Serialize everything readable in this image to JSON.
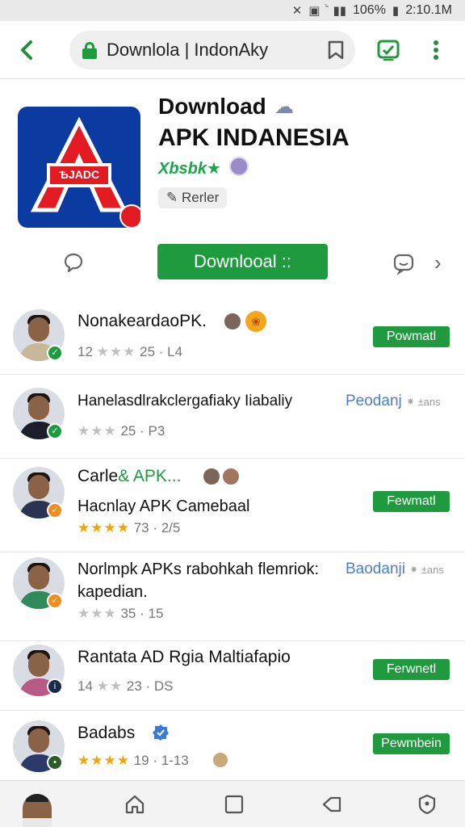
{
  "status_bar": {
    "battery": "106%",
    "time": "2:10.1M"
  },
  "browser": {
    "url_text": "Downlola | IndonAky"
  },
  "app": {
    "title_line1": "Download",
    "title_line2": "APK INDANESIA",
    "rating_text": "Xbsbk★",
    "reader_chip": "Rerler",
    "download_button": "Downlooal ::",
    "icon_text": "ѢJADC",
    "colors": {
      "accent": "#1f9a3e",
      "icon_bg": "#0b3aa0",
      "icon_red": "#e21b23"
    }
  },
  "list": [
    {
      "title": "NonakeardaoPK.",
      "meta_num": "12",
      "meta_stars": "★★★",
      "meta_rest": "25 · L4",
      "stars_color": "gray",
      "button": "Powmatl",
      "badge_color": "#1f9a3e"
    },
    {
      "title": "Hanelasdlrakclergafiaky Iiabaliy",
      "link": "Peodanj",
      "link_more": "⁕ ±ans",
      "meta_num": "",
      "meta_stars": "★★★",
      "meta_rest": "25 · P3",
      "stars_color": "gray",
      "badge_color": "#1f9a3e"
    },
    {
      "title_pre": "Carle",
      "title_amp": "&",
      "title_post": "APK...",
      "subtitle": "Hacnlay APK Camebaal",
      "meta_num": "",
      "meta_stars": "★★★★",
      "meta_rest": "73 · 2/5",
      "stars_color": "gold",
      "button": "Fewmatl",
      "badge_color": "#f28c1c"
    },
    {
      "title": "Norlmpk APKs rabohkah flemriok:",
      "link": "Baodanji",
      "link_more": "⁕ ±ans",
      "subtitle": "kapedian.",
      "meta_num": "",
      "meta_stars": "★★★",
      "meta_rest": "35 · 15",
      "stars_color": "gray",
      "badge_color": "#f28c1c"
    },
    {
      "title": "Rantata AD Rgia Maltiafapio",
      "meta_num": "14",
      "meta_stars": "★★",
      "meta_rest": "23 · DS",
      "stars_color": "gray",
      "button": "Ferwnetl",
      "badge_color": "#1b2a4a"
    },
    {
      "title": "Badabs",
      "meta_num": "",
      "meta_stars": "★★★★",
      "meta_rest": "19 · 1-13",
      "stars_color": "gold",
      "button": "Pewmbein",
      "badge_color": "#2f5a2a"
    }
  ]
}
